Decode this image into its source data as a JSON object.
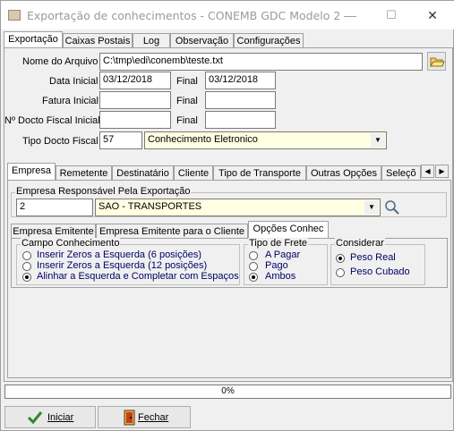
{
  "window": {
    "title": "Exportação de conhecimentos - CONEMB GDC Modelo 2",
    "minimize": "—",
    "maximize": "☐",
    "close": "✕"
  },
  "main_tabs": [
    "Exportação",
    "Caixas Postais",
    "Log",
    "Observação",
    "Configurações"
  ],
  "form": {
    "nome_arquivo_label": "Nome do Arquivo",
    "nome_arquivo_value": "C:\\tmp\\edi\\conemb\\teste.txt",
    "data_inicial_label": "Data Inicial",
    "data_inicial_value": "03/12/2018",
    "final_label": "Final",
    "data_final_value": "03/12/2018",
    "fatura_inicial_label": "Fatura Inicial",
    "fatura_final_label": "Final",
    "fatura_inicial_value": "",
    "fatura_final_value": "",
    "nf_inicial_label": "Nº Docto Fiscal Inicial",
    "nf_final_label": "Final",
    "nf_inicial_value": "",
    "nf_final_value": "",
    "tipo_docto_label": "Tipo Docto Fiscal",
    "tipo_docto_code": "57",
    "tipo_docto_value": "Conhecimento Eletronico"
  },
  "sub_tabs": [
    "Empresa",
    "Remetente",
    "Destinatário",
    "Cliente",
    "Tipo de Transporte",
    "Outras Opções",
    "Seleçõ"
  ],
  "empresa": {
    "group_title": "Empresa Responsável Pela Exportação",
    "code": "2",
    "name": "SAO - TRANSPORTES"
  },
  "inner_tabs": [
    "Empresa Emitente",
    "Empresa Emitente para o Cliente",
    "Opções Conhec"
  ],
  "campo_conhecimento": {
    "title": "Campo Conhecimento",
    "options": [
      {
        "label": "Inserir Zeros a Esquerda (6 posições)",
        "selected": false
      },
      {
        "label": "Inserir Zeros a Esquerda (12 posições)",
        "selected": false
      },
      {
        "label": "Alinhar a Esquerda e Completar com Espaços",
        "selected": true
      }
    ]
  },
  "tipo_frete": {
    "title": "Tipo de Frete",
    "options": [
      {
        "label": "A Pagar",
        "selected": false
      },
      {
        "label": "Pago",
        "selected": false
      },
      {
        "label": "Ambos",
        "selected": true
      }
    ]
  },
  "considerar": {
    "title": "Considerar",
    "options": [
      {
        "label": "Peso Real",
        "selected": true
      },
      {
        "label": "Peso Cubado",
        "selected": false
      }
    ]
  },
  "progress": {
    "label": "0%",
    "value": 0
  },
  "buttons": {
    "iniciar": "Iniciar",
    "fechar": "Fechar"
  }
}
